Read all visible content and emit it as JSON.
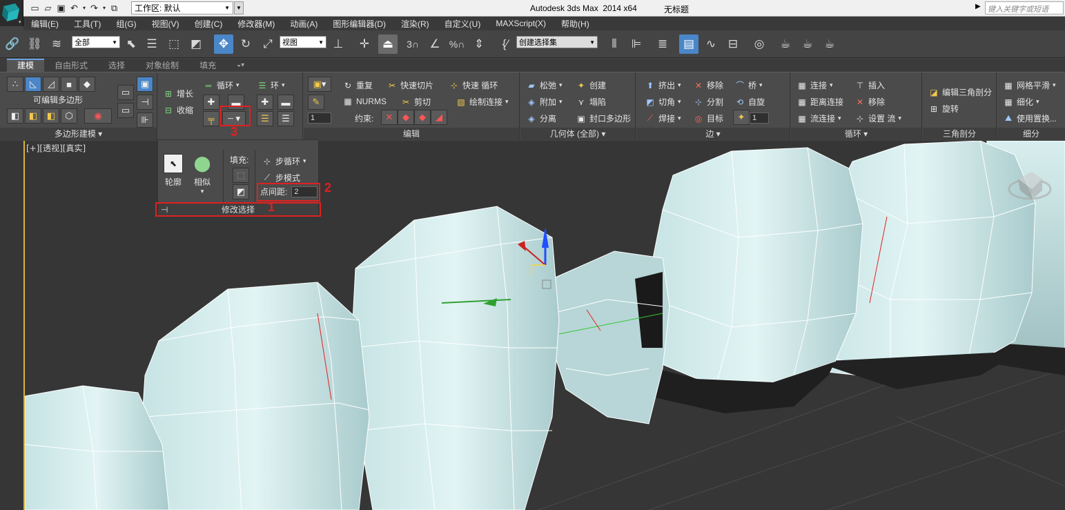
{
  "titlebar": {
    "workspace_label": "工作区: 默认",
    "title": "Autodesk 3ds Max  2014 x64",
    "filename": "无标题",
    "search_placeholder": "键入关键字或短语"
  },
  "menu": [
    "编辑(E)",
    "工具(T)",
    "组(G)",
    "视图(V)",
    "创建(C)",
    "修改器(M)",
    "动画(A)",
    "图形编辑器(D)",
    "渲染(R)",
    "自定义(U)",
    "MAXScript(X)",
    "帮助(H)"
  ],
  "toolbar": {
    "filter_select": "全部",
    "ref_coord_select": "视图",
    "snap_3": "3",
    "snap_percent": "%",
    "named_selection": "创建选择集"
  },
  "ribbon_tabs": [
    "建模",
    "自由形式",
    "选择",
    "对象绘制",
    "填充"
  ],
  "ribbon": {
    "poly_modeling": {
      "label": "可编辑多边形",
      "title": "多边形建模"
    },
    "modify_selection": {
      "grow": "增长",
      "shrink": "收缩",
      "loop": "循环",
      "ring": "环"
    },
    "edit": {
      "repeat": "重复",
      "quickslice": "快速切片",
      "quickloop": "快速 循环",
      "nurms": "NURMS",
      "cut": "剪切",
      "paintconnect": "绘制连接",
      "constraint": "约束:",
      "spin_value": "1",
      "title": "编辑"
    },
    "geometry": {
      "relax": "松弛",
      "create": "创建",
      "attach": "附加",
      "collapse": "塌陷",
      "detach": "分离",
      "cap": "封口多边形",
      "title": "几何体 (全部)"
    },
    "edges": {
      "extrude": "挤出",
      "remove": "移除",
      "bridge": "桥",
      "chamfer": "切角",
      "split": "分割",
      "spin": "自旋",
      "weld": "焊接",
      "target": "目标",
      "spin_value": "1",
      "title": "边"
    },
    "loops": {
      "connect": "连接",
      "insert": "插入",
      "distconnect": "距离连接",
      "remove": "移除",
      "flowconnect": "流连接",
      "setflow": "设置 流",
      "title": "循环"
    },
    "tris": {
      "edittri": "编辑三角剖分",
      "turn": "旋转",
      "title": "三角剖分"
    },
    "subdiv": {
      "meshsmooth": "网格平滑",
      "tessellate": "细化",
      "usedisp": "使用置换...",
      "title": "细分"
    }
  },
  "subpanel": {
    "outline": "轮廓",
    "similar": "相似",
    "fill": "填充:",
    "steploop": "步循环",
    "stepmode": "步模式",
    "dotgap_label": "点间距:",
    "dotgap_value": "2",
    "title": "修改选择"
  },
  "annotations": {
    "one": "1",
    "two": "2",
    "three": "3"
  },
  "viewport": {
    "label": "[+][透视][真实]"
  }
}
